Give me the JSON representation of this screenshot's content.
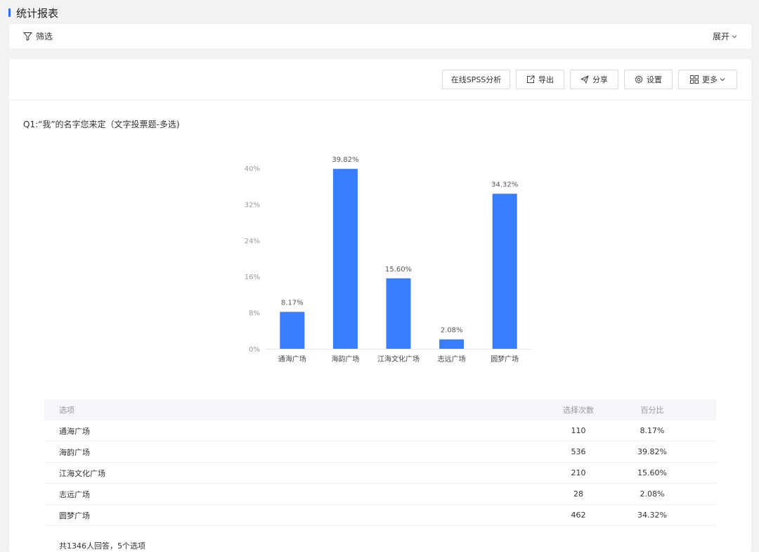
{
  "page": {
    "title": "统计报表"
  },
  "filter": {
    "label": "筛选",
    "expand_label": "展开"
  },
  "toolbar": {
    "spss_label": "在线SPSS分析",
    "export_label": "导出",
    "share_label": "分享",
    "settings_label": "设置",
    "more_label": "更多"
  },
  "question": {
    "title": "Q1:“我”的名字您来定（文字投票题-多选)"
  },
  "chart_data": {
    "type": "bar",
    "categories": [
      "通海广场",
      "海韵广场",
      "江海文化广场",
      "志远广场",
      "圆梦广场"
    ],
    "values": [
      8.17,
      39.82,
      15.6,
      2.08,
      34.32
    ],
    "data_labels": [
      "8.17%",
      "39.82%",
      "15.60%",
      "2.08%",
      "34.32%"
    ],
    "yticks": [
      "0%",
      "8%",
      "16%",
      "24%",
      "32%",
      "40%"
    ],
    "ylim": [
      0,
      40
    ],
    "grid": false,
    "color": "#377dff"
  },
  "table": {
    "headers": [
      "选项",
      "选择次数",
      "百分比"
    ],
    "rows": [
      {
        "option": "通海广场",
        "count": "110",
        "percent": "8.17%"
      },
      {
        "option": "海韵广场",
        "count": "536",
        "percent": "39.82%"
      },
      {
        "option": "江海文化广场",
        "count": "210",
        "percent": "15.60%"
      },
      {
        "option": "志远广场",
        "count": "28",
        "percent": "2.08%"
      },
      {
        "option": "圆梦广场",
        "count": "462",
        "percent": "34.32%"
      }
    ]
  },
  "summary": "共1346人回答，5个选项"
}
